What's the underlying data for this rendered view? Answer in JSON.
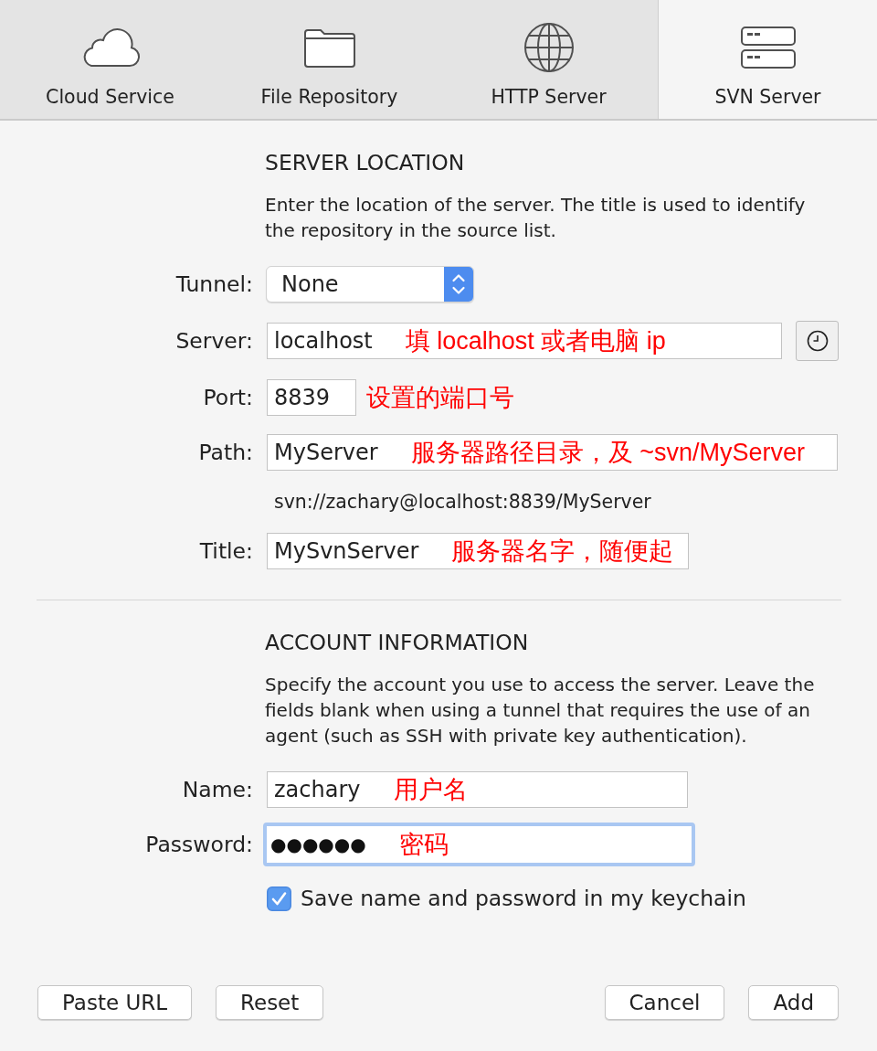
{
  "tabs": [
    {
      "label": "Cloud Service",
      "selected": false
    },
    {
      "label": "File Repository",
      "selected": false
    },
    {
      "label": "HTTP Server",
      "selected": false
    },
    {
      "label": "SVN Server",
      "selected": true
    }
  ],
  "server_location": {
    "heading": "SERVER LOCATION",
    "description": "Enter the location of the server. The title is used to identify the repository in the source list.",
    "rows": [
      {
        "kind": "popup",
        "label": "Tunnel:",
        "value": "None"
      },
      {
        "kind": "text",
        "label": "Server:",
        "value": "localhost",
        "annotation": "填 localhost 或者电脑 ip",
        "history_button": true
      },
      {
        "kind": "text",
        "label": "Port:",
        "value": "8839",
        "note": "设置的端口号"
      },
      {
        "kind": "text",
        "label": "Path:",
        "value": "MyServer",
        "annotation": "服务器路径目录，及 ~svn/MyServer"
      },
      {
        "kind": "info",
        "text": "svn://zachary@localhost:8839/MyServer"
      },
      {
        "kind": "text",
        "label": "Title:",
        "value": "MySvnServer",
        "annotation": "服务器名字，随便起"
      }
    ]
  },
  "account_information": {
    "heading": "ACCOUNT INFORMATION",
    "description": "Specify the account you use to access the server. Leave the fields blank when using a tunnel that requires the use of an agent (such as SSH with private key authentication).",
    "rows": [
      {
        "kind": "text",
        "label": "Name:",
        "value": "zachary",
        "annotation": "用户名",
        "focused": false
      },
      {
        "kind": "password",
        "label": "Password:",
        "value": "●●●●●●",
        "annotation": "密码",
        "focused": true
      }
    ],
    "checkbox": {
      "label": "Save name and password in my keychain",
      "checked": true
    }
  },
  "buttons": {
    "left": [
      "Paste URL",
      "Reset"
    ],
    "right": [
      "Cancel",
      "Add"
    ]
  }
}
